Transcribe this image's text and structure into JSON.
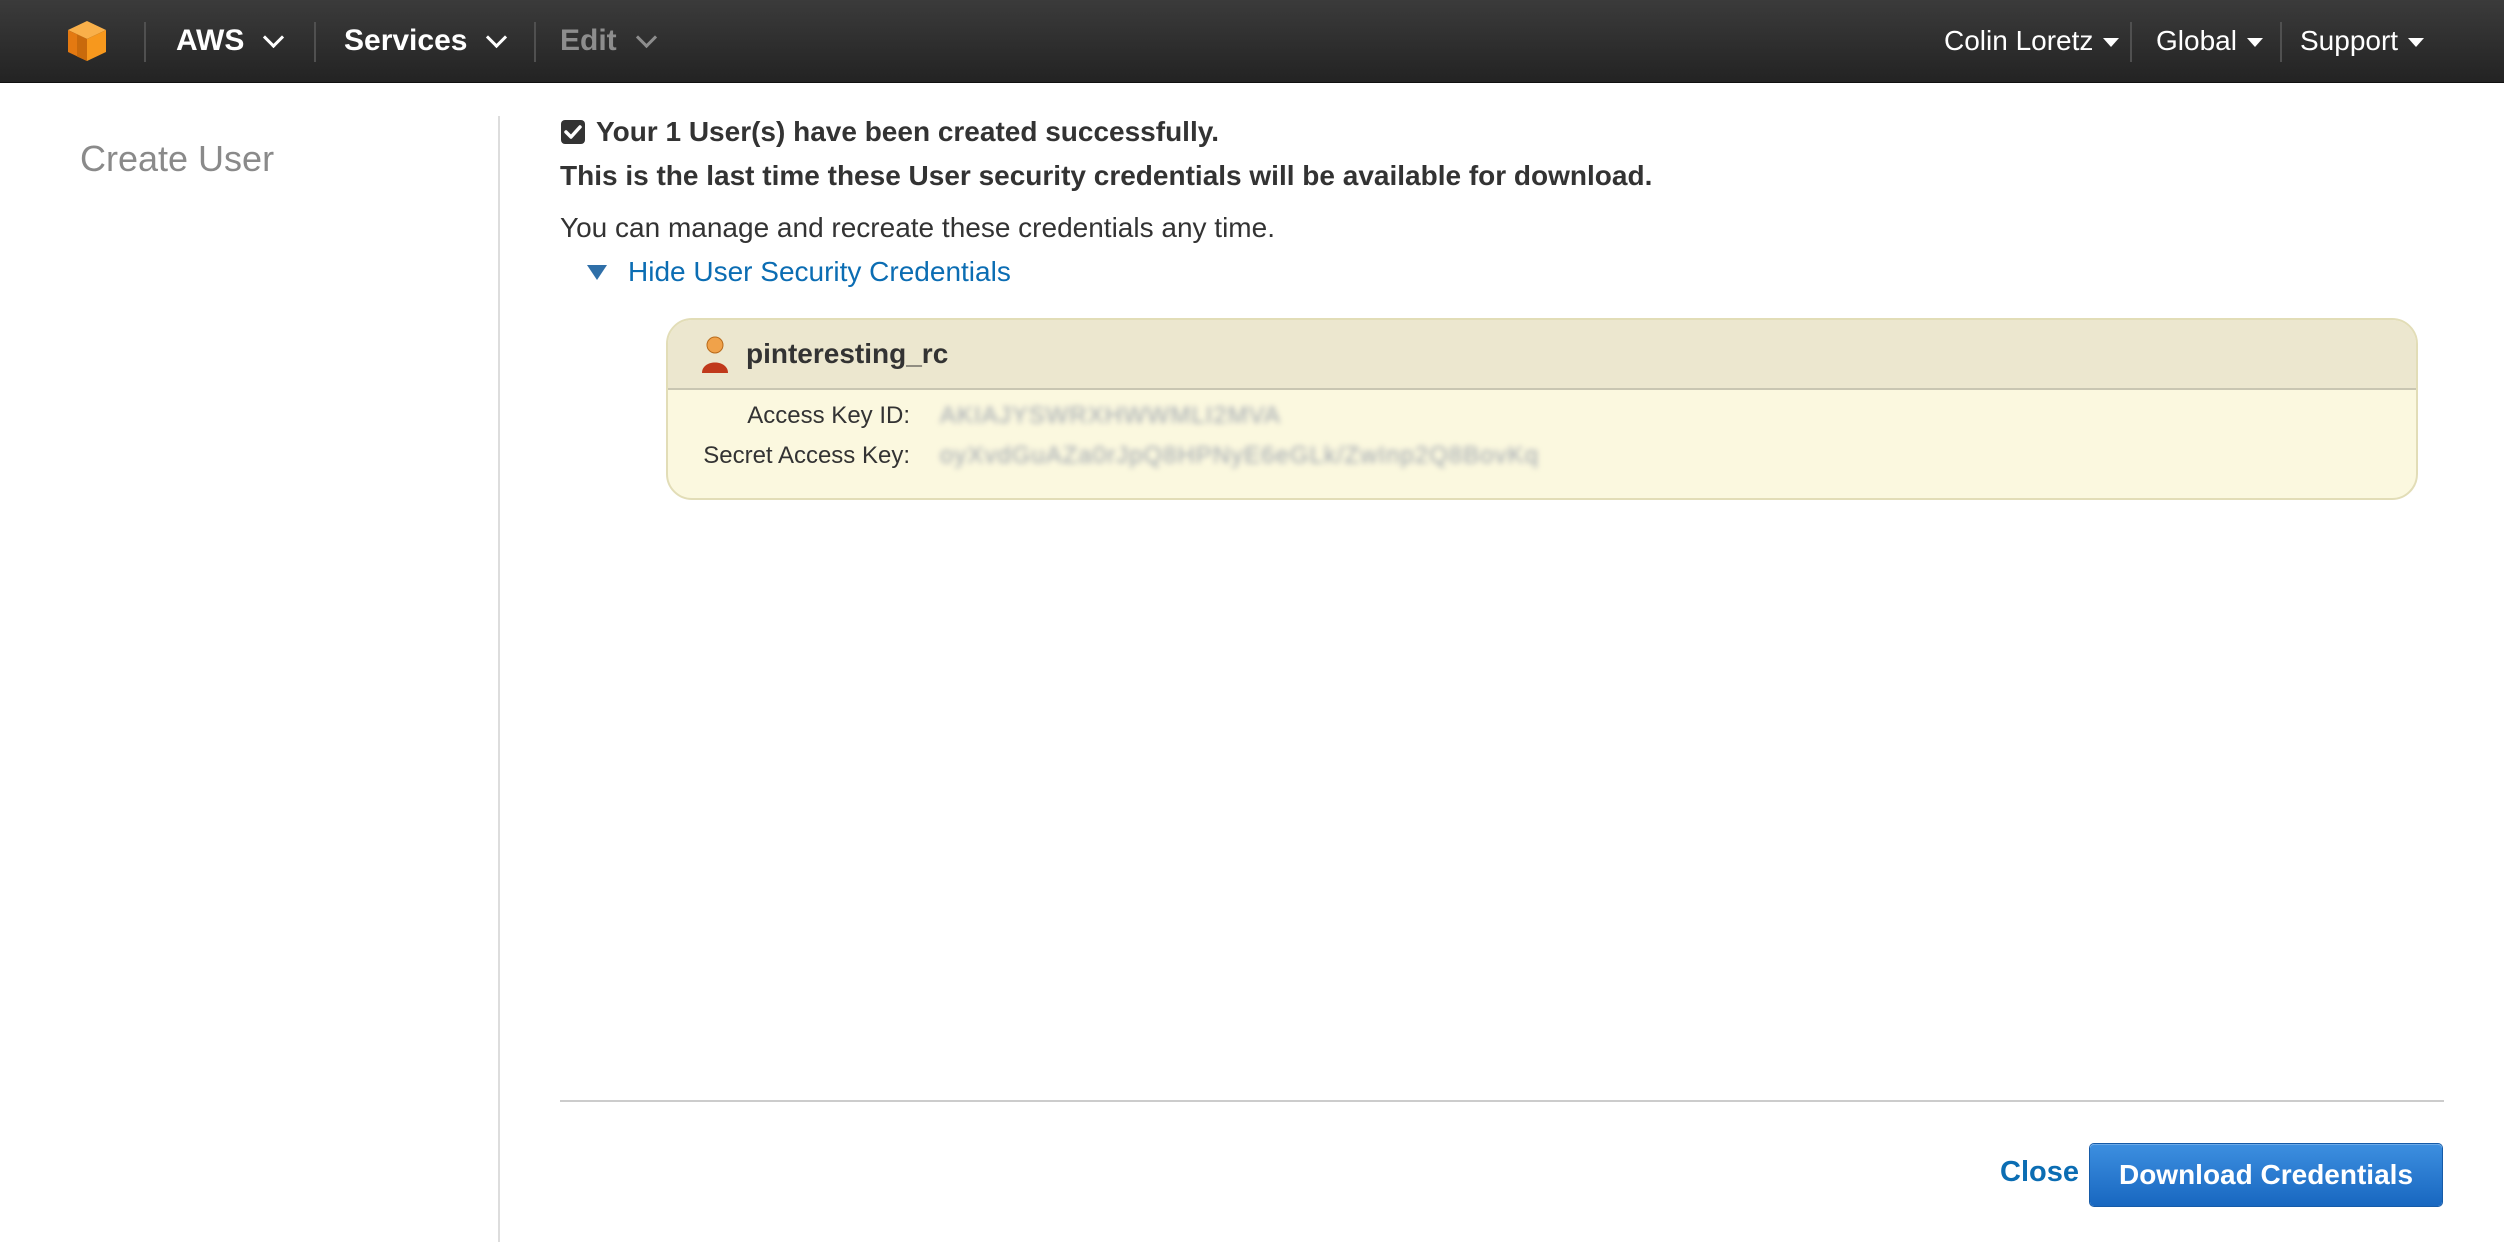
{
  "topnav": {
    "aws_label": "AWS",
    "services_label": "Services",
    "edit_label": "Edit",
    "user_label": "Colin Loretz",
    "region_label": "Global",
    "support_label": "Support"
  },
  "sidebar": {
    "title": "Create User"
  },
  "main": {
    "success_message": "Your 1 User(s) have been created successfully.",
    "warning_message": "This is the last time these User security credentials will be available for download.",
    "info_message": "You can manage and recreate these credentials any time.",
    "toggle_label": "Hide User Security Credentials",
    "credentials": {
      "username": "pinteresting_rc",
      "access_key_label": "Access Key ID:",
      "access_key_value": "AKIAJYSWRXHWWMLI2MVA",
      "secret_key_label": "Secret Access Key:",
      "secret_key_value": "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"
    }
  },
  "footer": {
    "close_label": "Close",
    "download_label": "Download Credentials"
  },
  "colors": {
    "link": "#0b6db3",
    "button": "#1f6fc5",
    "aws_orange": "#f7981d"
  }
}
